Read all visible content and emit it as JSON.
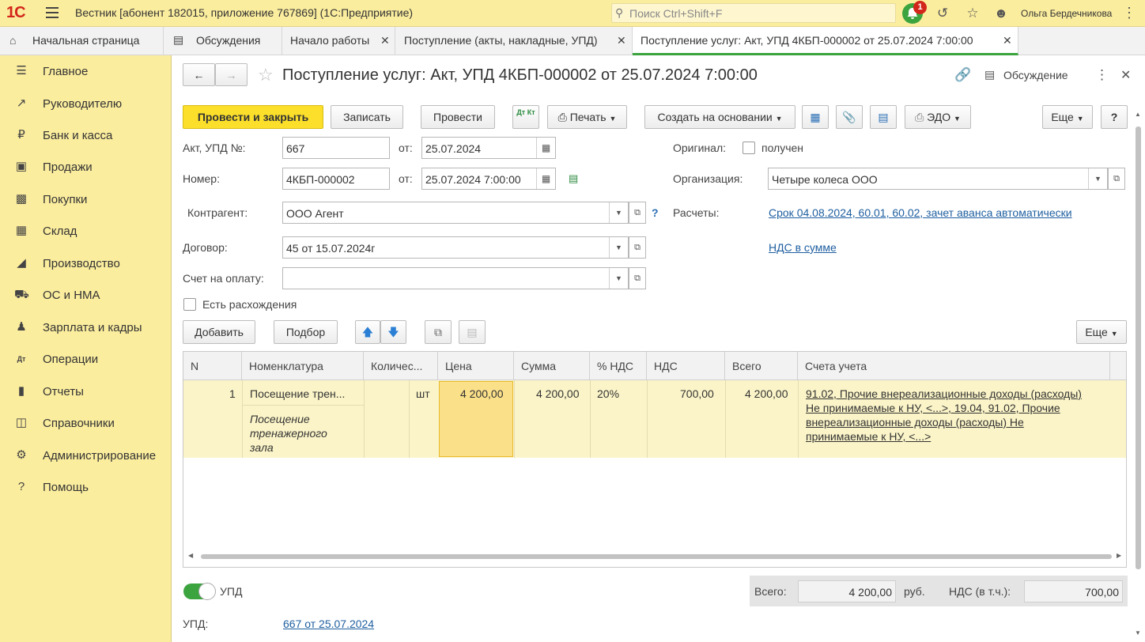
{
  "topbar": {
    "logo": "1С",
    "title": "Вестник [абонент 182015, приложение 767869]  (1С:Предприятие)",
    "search_placeholder": "Поиск Ctrl+Shift+F",
    "notifications_count": "1",
    "user": "Ольга Бердечникова"
  },
  "tabs": [
    {
      "label": "Начальная страница"
    },
    {
      "label": "Обсуждения"
    },
    {
      "label": "Начало работы"
    },
    {
      "label": "Поступление (акты, накладные, УПД)"
    },
    {
      "label": "Поступление услуг: Акт, УПД 4КБП-000002 от 25.07.2024 7:00:00"
    }
  ],
  "sidebar": {
    "items": [
      {
        "label": "Главное",
        "icon": "menu-icon"
      },
      {
        "label": "Руководителю",
        "icon": "trend-icon"
      },
      {
        "label": "Банк и касса",
        "icon": "ruble-icon"
      },
      {
        "label": "Продажи",
        "icon": "bag-icon"
      },
      {
        "label": "Покупки",
        "icon": "cart-icon"
      },
      {
        "label": "Склад",
        "icon": "warehouse-icon"
      },
      {
        "label": "Производство",
        "icon": "factory-icon"
      },
      {
        "label": "ОС и НМА",
        "icon": "truck-icon"
      },
      {
        "label": "Зарплата и кадры",
        "icon": "person-icon"
      },
      {
        "label": "Операции",
        "icon": "dt-kt-icon"
      },
      {
        "label": "Отчеты",
        "icon": "bar-chart-icon"
      },
      {
        "label": "Справочники",
        "icon": "book-icon"
      },
      {
        "label": "Администрирование",
        "icon": "gear-icon"
      },
      {
        "label": "Помощь",
        "icon": "question-icon"
      }
    ]
  },
  "doc": {
    "title": "Поступление услуг: Акт, УПД 4КБП-000002 от 25.07.2024 7:00:00",
    "discussion": "Обсуждение"
  },
  "toolbar": {
    "post_close": "Провести и закрыть",
    "save": "Записать",
    "post": "Провести",
    "dtkt": "Дт Кт",
    "print": "Печать",
    "create_based": "Создать на основании",
    "edo": "ЭДО",
    "more": "Еще",
    "help": "?"
  },
  "form": {
    "act_label": "Акт, УПД №:",
    "act_value": "667",
    "from_label": "от:",
    "act_date": "25.07.2024",
    "number_label": "Номер:",
    "number_value": "4КБП-000002",
    "number_date": "25.07.2024  7:00:00",
    "contractor_label": "Контрагент:",
    "contractor_value": "ООО Агент",
    "contract_label": "Договор:",
    "contract_value": "45 от 15.07.2024г",
    "invoice_label": "Счет на оплату:",
    "invoice_value": "",
    "discrepancy_label": "Есть расхождения",
    "original_label": "Оригинал:",
    "received_label": "получен",
    "org_label": "Организация:",
    "org_value": "Четыре колеса ООО",
    "settlements_label": "Расчеты:",
    "settlements_link": "Срок 04.08.2024, 60.01, 60.02, зачет аванса автоматически",
    "vat_link": "НДС в сумме",
    "help_q": "?"
  },
  "table_toolbar": {
    "add": "Добавить",
    "pick": "Подбор",
    "more": "Еще"
  },
  "table": {
    "headers": [
      "N",
      "Номенклатура",
      "Количес...",
      "Цена",
      "Сумма",
      "% НДС",
      "НДС",
      "Всего",
      "Счета учета"
    ],
    "rows": [
      {
        "n": "1",
        "nomenclature": "Посещение трен...",
        "content_l1": "Посещение",
        "content_l2": "тренажерного",
        "content_l3": "зала",
        "unit": "шт",
        "price": "4 200,00",
        "sum": "4 200,00",
        "vat_rate": "20%",
        "vat": "700,00",
        "total": "4 200,00",
        "acc_l1": "91.02, Прочие внереализационные доходы (расходы)",
        "acc_l2": "Не принимаемые к НУ, <...>, 19.04, 91.02, Прочие",
        "acc_l3": "внереализационные доходы (расходы) Не",
        "acc_l4": "принимаемые к НУ, <...>"
      }
    ]
  },
  "footer": {
    "upd_toggle": "УПД",
    "total_label": "Всего:",
    "total_value": "4 200,00",
    "currency": "руб.",
    "vat_label": "НДС (в т.ч.):",
    "vat_value": "700,00",
    "upd_label": "УПД:",
    "upd_link": "667 от 25.07.2024"
  },
  "colors": {
    "accent_yellow": "#fbdf2a",
    "sidebar_bg": "#fbed9e",
    "active_tab": "#3ca43f",
    "link": "#1f5fa0"
  }
}
